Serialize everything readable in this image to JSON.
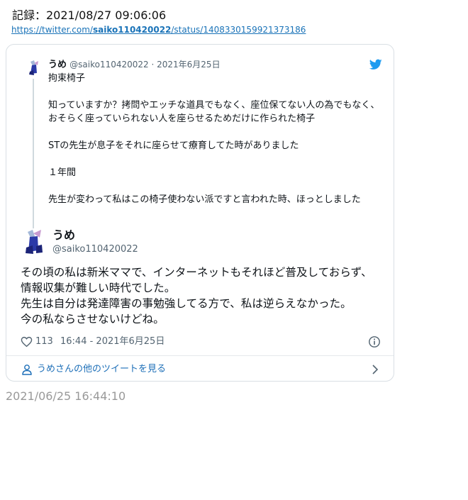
{
  "record": {
    "title": "記録：2021/08/27 09:06:06",
    "url_prefix": "https://twitter.com/",
    "url_user": "saiko110420022",
    "url_suffix": "/status/1408330159921373186"
  },
  "parent_tweet": {
    "name": "うめ",
    "handle": "@saiko110420022",
    "separator": " · ",
    "date": "2021年6月25日",
    "text": "拘束椅子\n\n知っていますか？拷問やエッチな道具でもなく、座位保てない人の為でもなく、おそらく座っていられない人を座らせるためだけに作られた椅子\n\nSTの先生が息子をそれに座らせて療育してた時がありました\n\n１年間\n\n先生が変わって私はこの椅子使わない派ですと言われた時、ほっとしました"
  },
  "main_tweet": {
    "name": "うめ",
    "handle": "@saiko110420022",
    "text": "その頃の私は新米ママで、インターネットもそれほど普及しておらず、情報収集が難しい時代でした。\n先生は自分は発達障害の事勉強してる方で、私は逆らえなかった。\n今の私ならさせないけどね。",
    "likes": "113",
    "timestamp": "16:44 - 2021年6月25日"
  },
  "more_link": {
    "label": "うめさんの他のツイートを見る"
  },
  "footer": {
    "date": "2021/06/25 16:44:10"
  },
  "icons": {
    "bird": "twitter-bird-icon",
    "heart": "heart-icon",
    "info": "info-icon",
    "user": "user-icon",
    "chevron": "chevron-right-icon"
  },
  "colors": {
    "link": "#1a73b8",
    "twitter_blue": "#1d9bf0",
    "secondary_text": "#536471",
    "footer_text": "#999999"
  }
}
